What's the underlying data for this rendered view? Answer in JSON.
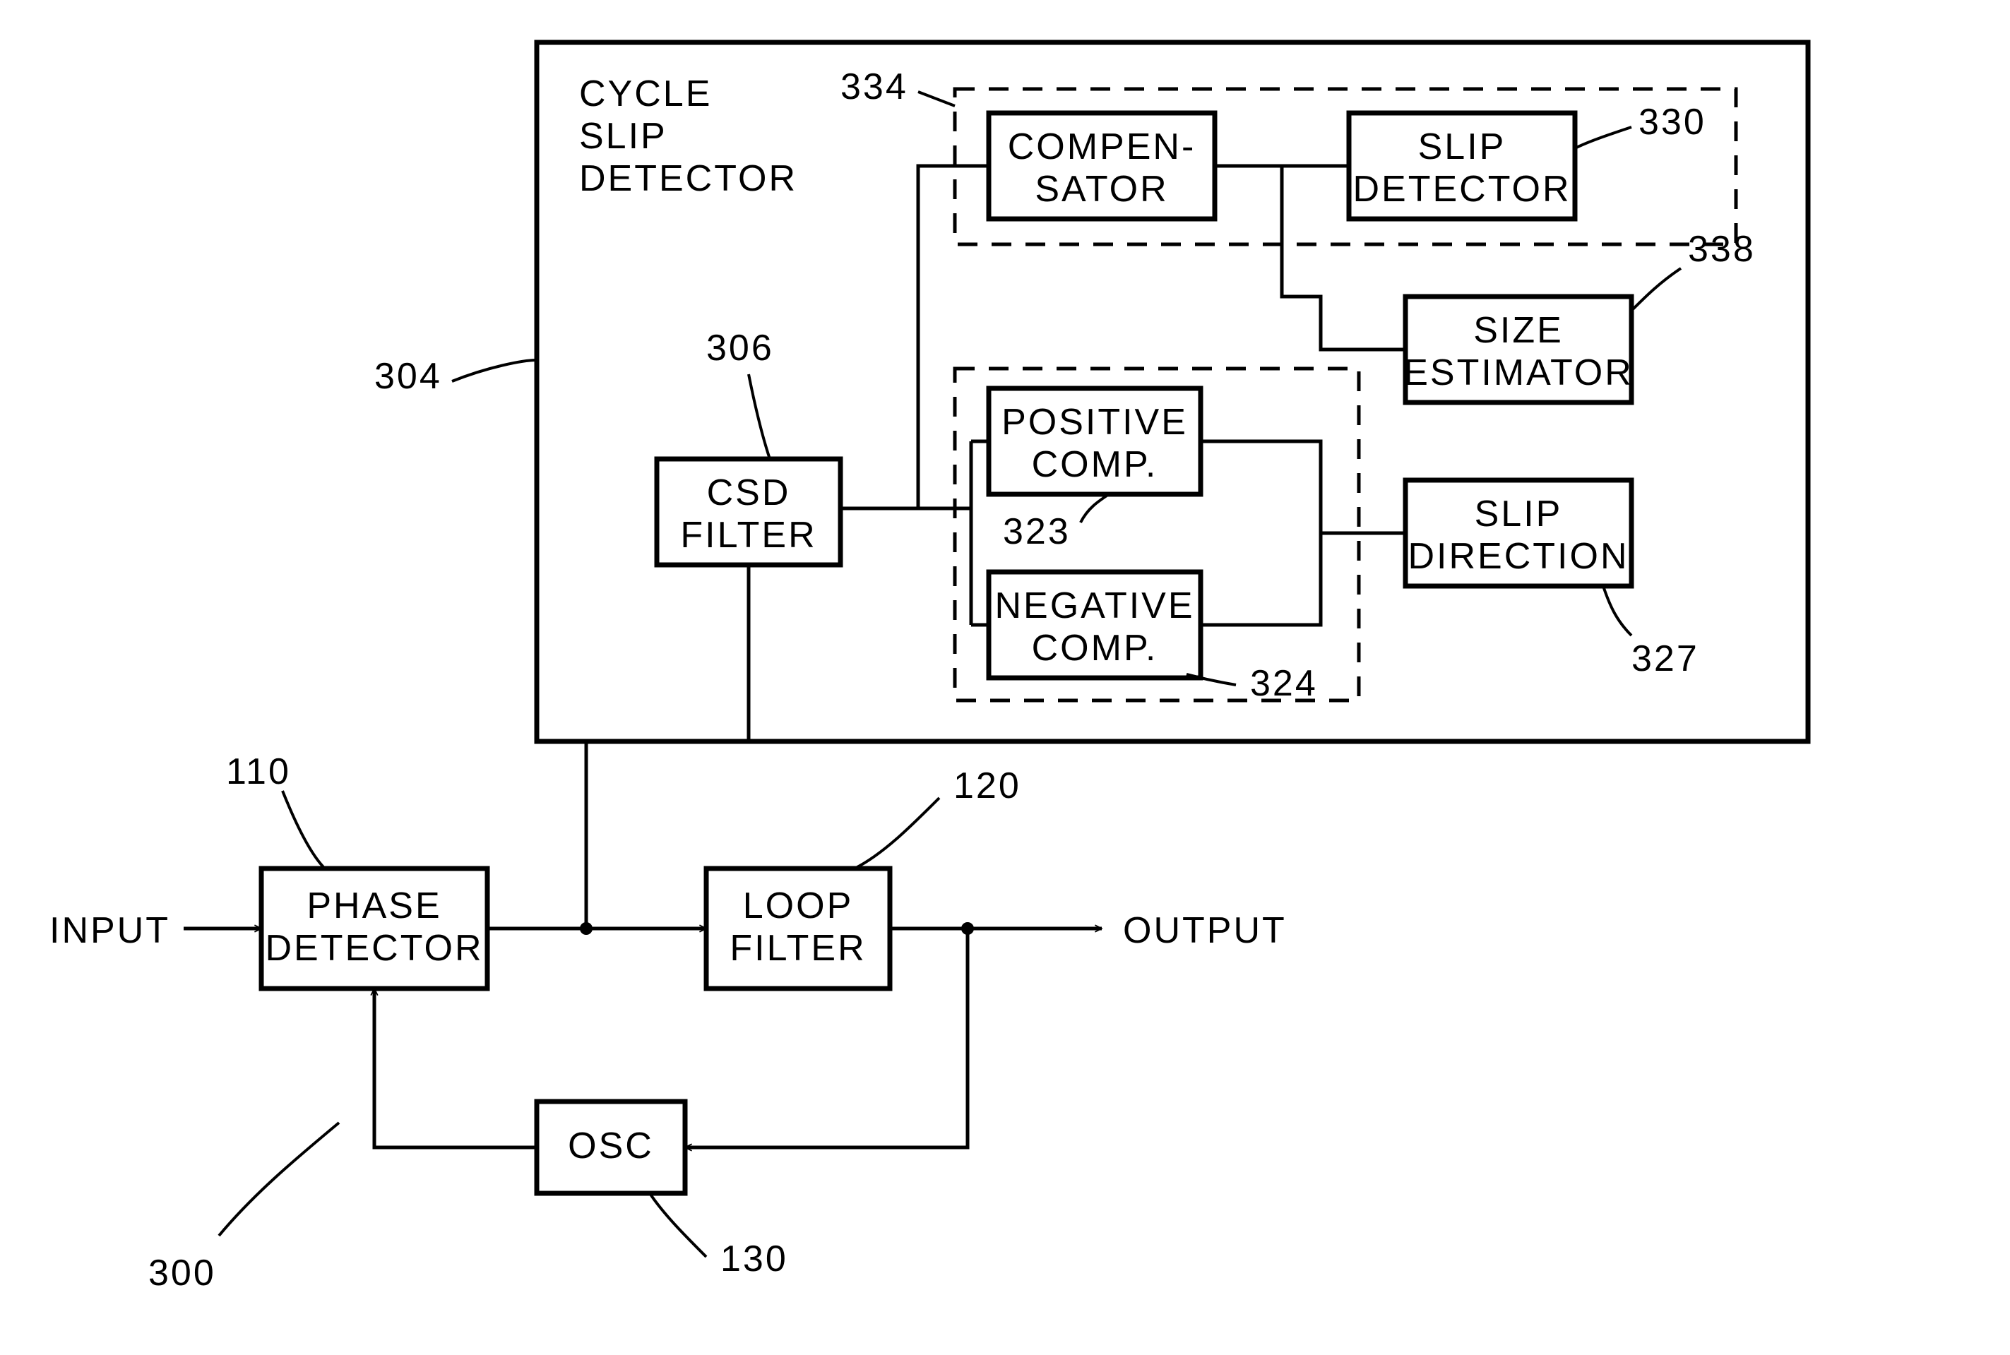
{
  "title": "CYCLE SLIP DETECTOR",
  "io": {
    "input": "INPUT",
    "output": "OUTPUT"
  },
  "blocks": {
    "phase_detector": {
      "l1": "PHASE",
      "l2": "DETECTOR"
    },
    "loop_filter": {
      "l1": "LOOP",
      "l2": "FILTER"
    },
    "osc": {
      "l1": "OSC"
    },
    "csd_filter": {
      "l1": "CSD",
      "l2": "FILTER"
    },
    "compensator": {
      "l1": "COMPEN-",
      "l2": "SATOR"
    },
    "slip_detector": {
      "l1": "SLIP",
      "l2": "DETECTOR"
    },
    "size_estimator": {
      "l1": "SIZE",
      "l2": "ESTIMATOR"
    },
    "pos_comp": {
      "l1": "POSITIVE",
      "l2": "COMP."
    },
    "neg_comp": {
      "l1": "NEGATIVE",
      "l2": "COMP."
    },
    "slip_direction": {
      "l1": "SLIP",
      "l2": "DIRECTION"
    }
  },
  "refs": {
    "r300": "300",
    "r304": "304",
    "r110": "110",
    "r120": "120",
    "r130": "130",
    "r306": "306",
    "r334": "334",
    "r330": "330",
    "r338": "338",
    "r323": "323",
    "r324": "324",
    "r327": "327"
  }
}
